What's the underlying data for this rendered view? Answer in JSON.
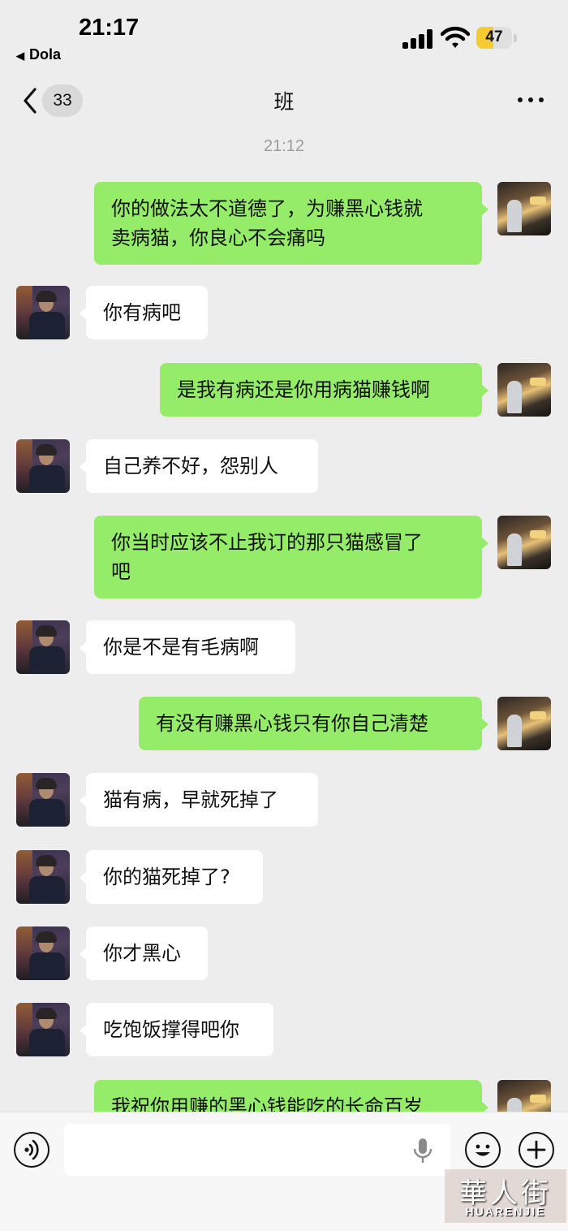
{
  "status_bar": {
    "time": "21:17",
    "back_app": "Dola",
    "battery": "47",
    "battery_level": 0.47,
    "battery_color": "#f4cc2f"
  },
  "nav": {
    "unread_count": "33",
    "title": "班",
    "more_icon": "more-dots-icon"
  },
  "chat": {
    "timestamp": "21:12",
    "messages": [
      {
        "sender": "me",
        "lines": [
          "你的做法太不道德了，为赚黑心钱就",
          "卖病猫，你良心不会痛吗"
        ]
      },
      {
        "sender": "other",
        "lines": [
          "你有病吧"
        ]
      },
      {
        "sender": "me",
        "lines": [
          "是我有病还是你用病猫赚钱啊"
        ]
      },
      {
        "sender": "other",
        "lines": [
          "自己养不好，怨别人"
        ]
      },
      {
        "sender": "me",
        "lines": [
          "你当时应该不止我订的那只猫感冒了",
          "吧"
        ]
      },
      {
        "sender": "other",
        "lines": [
          "你是不是有毛病啊"
        ]
      },
      {
        "sender": "me",
        "lines": [
          "有没有赚黑心钱只有你自己清楚"
        ]
      },
      {
        "sender": "other",
        "lines": [
          "猫有病，早就死掉了"
        ]
      },
      {
        "sender": "other",
        "lines": [
          "你的猫死掉了?"
        ]
      },
      {
        "sender": "other",
        "lines": [
          "你才黑心"
        ]
      },
      {
        "sender": "other",
        "lines": [
          "吃饱饭撑得吧你"
        ]
      },
      {
        "sender": "me",
        "lines": [
          "我祝你用赚的黑心钱能吃的长命百岁"
        ]
      }
    ]
  },
  "input_bar": {
    "voice_icon": "voice-icon",
    "mic_icon": "microphone-icon",
    "emoji_icon": "emoji-icon",
    "plus_icon": "plus-icon"
  },
  "watermark": {
    "text": "華人街",
    "sub": "HUARENJIE"
  },
  "colors": {
    "outgoing_bubble": "#95ec69",
    "incoming_bubble": "#ffffff",
    "background": "#ededed"
  }
}
